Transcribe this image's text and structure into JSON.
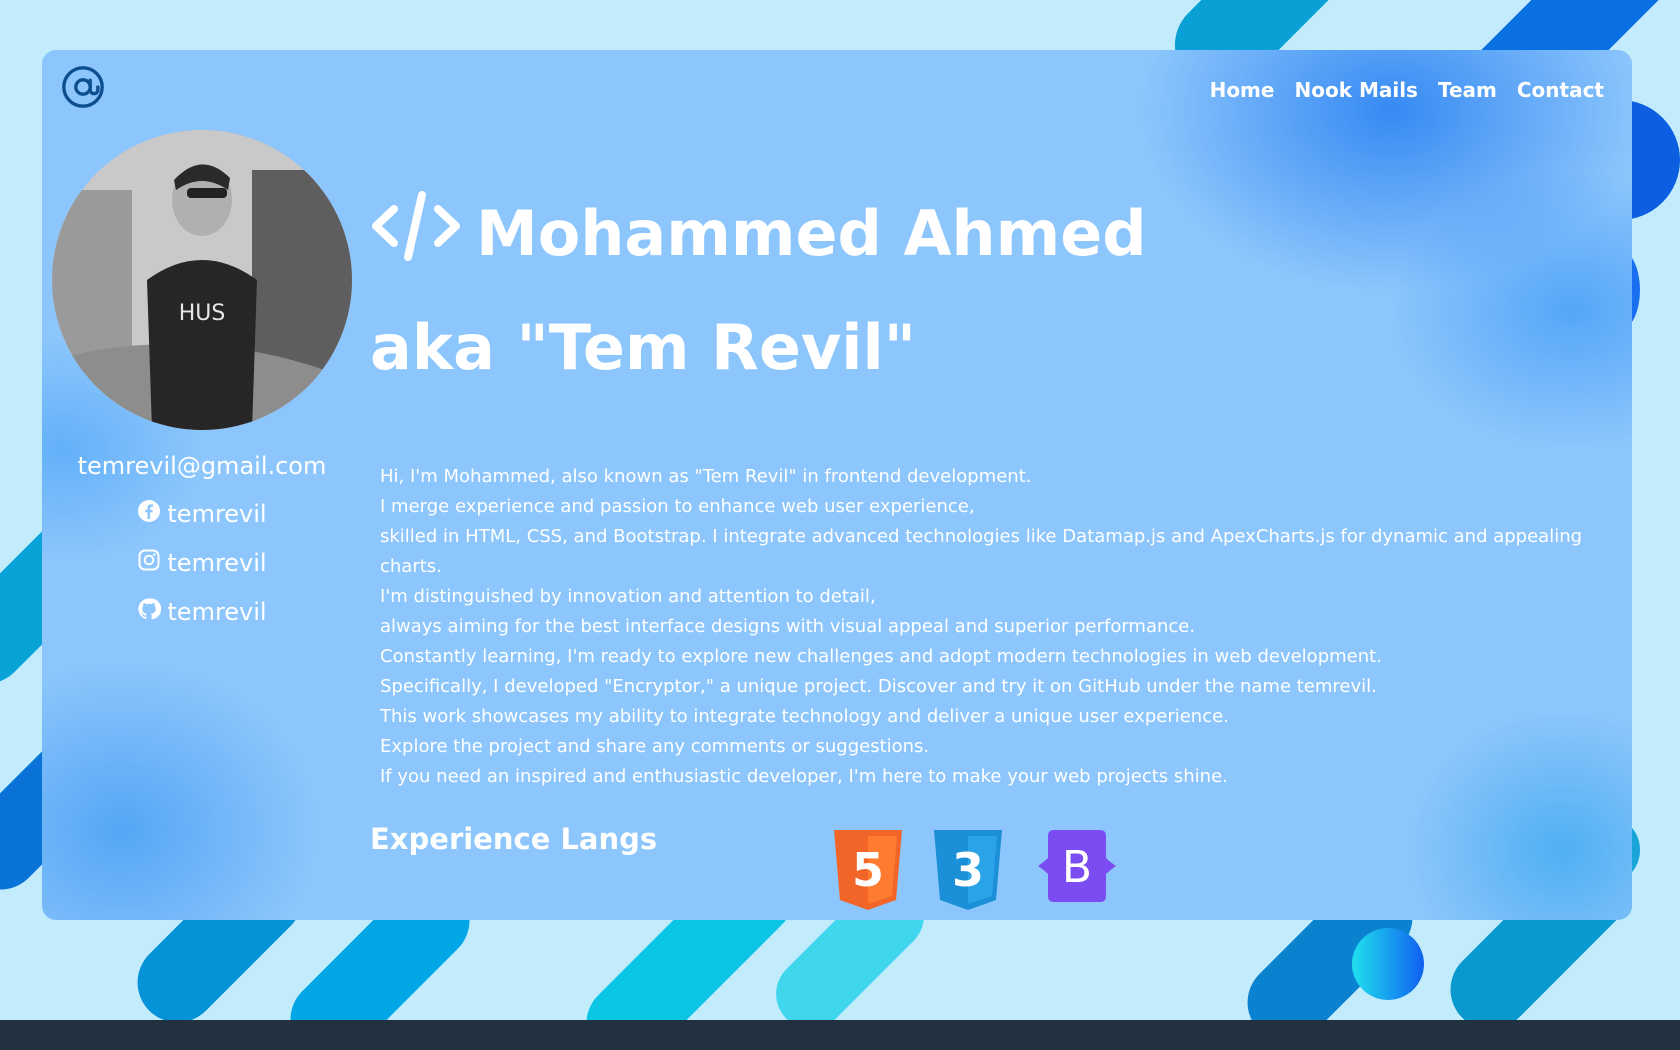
{
  "nav": {
    "logo_icon": "at-sign-icon",
    "items": [
      {
        "label": "Home"
      },
      {
        "label": "Nook Mails"
      },
      {
        "label": "Team"
      },
      {
        "label": "Contact"
      }
    ]
  },
  "profile": {
    "title_line1": "Mohammed Ahmed",
    "title_line2": "aka \"Tem Revil\"",
    "title_icon": "code-icon",
    "email": "temrevil@gmail.com",
    "socials": [
      {
        "icon": "facebook-icon",
        "handle": "temrevil"
      },
      {
        "icon": "instagram-icon",
        "handle": "temrevil"
      },
      {
        "icon": "github-icon",
        "handle": "temrevil"
      }
    ]
  },
  "bio": [
    "Hi, I'm Mohammed, also known as \"Tem Revil\" in frontend development.",
    "I merge experience and passion to enhance web user experience,",
    "skilled in HTML, CSS, and Bootstrap. I integrate advanced technologies like Datamap.js and ApexCharts.js for dynamic and appealing charts.",
    "I'm distinguished by innovation and attention to detail,",
    "always aiming for the best interface designs with visual appeal and superior performance.",
    "Constantly learning, I'm ready to explore new challenges and adopt modern technologies in web development.",
    "Specifically, I developed \"Encryptor,\" a unique project. Discover and try it on GitHub under the name temrevil.",
    "This work showcases my ability to integrate technology and deliver a unique user experience.",
    "Explore the project and share any comments or suggestions.",
    "If you need an inspired and enthusiastic developer, I'm here to make your web projects shine."
  ],
  "experience": {
    "title": "Experience Langs",
    "icons": [
      {
        "icon": "html5-icon",
        "label": "5",
        "color": "#f16529"
      },
      {
        "icon": "css3-icon",
        "label": "3",
        "color": "#1b8fd8"
      },
      {
        "icon": "bootstrap-icon",
        "label": "B",
        "color": "#7a4cf2"
      }
    ]
  },
  "colors": {
    "card": "#8cc6fc",
    "accent": "#1a76f0",
    "footer": "#22313f"
  }
}
